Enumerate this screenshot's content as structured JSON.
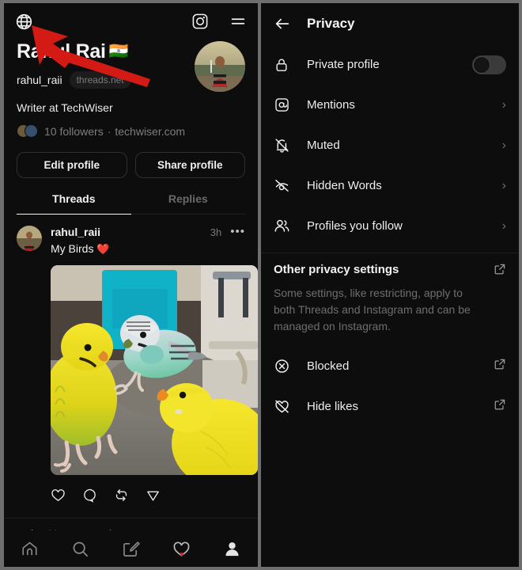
{
  "app": {
    "name": "Threads"
  },
  "left": {
    "topbar": {
      "globe_icon": "globe-icon",
      "instagram_icon": "instagram-icon",
      "menu_icon": "hamburger-menu-icon"
    },
    "profile": {
      "display_name": "Rahul Rai",
      "flag": "🇮🇳",
      "handle": "rahul_raii",
      "net_badge": "threads.net",
      "bio": "Writer at TechWiser",
      "followers": "10 followers",
      "separator": "·",
      "website": "techwiser.com",
      "edit_button": "Edit profile",
      "share_button": "Share profile"
    },
    "tabs": [
      {
        "label": "Threads",
        "active": true
      },
      {
        "label": "Replies",
        "active": false
      }
    ],
    "post": {
      "username": "rahul_raii",
      "time": "3h",
      "more": "•••",
      "text": "My Birds",
      "emoji": "❤️",
      "image_alt": "three budgerigar parakeets on a grey sofa",
      "actions": [
        "like-icon",
        "comment-icon",
        "repost-icon",
        "share-icon"
      ]
    },
    "repost_bar": {
      "icon": "repost-icon",
      "label": "You reposted"
    },
    "bottom_nav": [
      {
        "name": "home-icon",
        "badge": false
      },
      {
        "name": "search-icon",
        "badge": false
      },
      {
        "name": "compose-icon",
        "badge": false
      },
      {
        "name": "activity-heart-icon",
        "badge": true
      },
      {
        "name": "profile-icon",
        "badge": false
      }
    ]
  },
  "right": {
    "header": {
      "back": "←",
      "title": "Privacy"
    },
    "items": [
      {
        "icon": "lock-icon",
        "label": "Private profile",
        "control": "toggle",
        "toggle_on": false
      },
      {
        "icon": "at-mention-icon",
        "label": "Mentions",
        "control": "chevron"
      },
      {
        "icon": "bell-muted-icon",
        "label": "Muted",
        "control": "chevron"
      },
      {
        "icon": "eye-off-icon",
        "label": "Hidden Words",
        "control": "chevron"
      },
      {
        "icon": "people-icon",
        "label": "Profiles you follow",
        "control": "chevron"
      }
    ],
    "other": {
      "title": "Other privacy settings",
      "description": "Some settings, like restricting, apply to both Threads and Instagram and can be managed on Instagram.",
      "external_icon": "external-link-icon",
      "rows": [
        {
          "icon": "blocked-circle-x-icon",
          "label": "Blocked",
          "control": "external-link-icon"
        },
        {
          "icon": "heart-off-icon",
          "label": "Hide likes",
          "control": "external-link-icon"
        }
      ]
    },
    "chevron_glyph": "›"
  },
  "annotation": {
    "type": "arrow",
    "color": "#d31a14",
    "points_to": "globe-icon"
  },
  "colors": {
    "background": "#0d0d0d",
    "frame": "#6e6e6e",
    "text_primary": "#f2f2f2",
    "text_secondary": "#7d7d7d",
    "accent_red": "#d31a14"
  }
}
